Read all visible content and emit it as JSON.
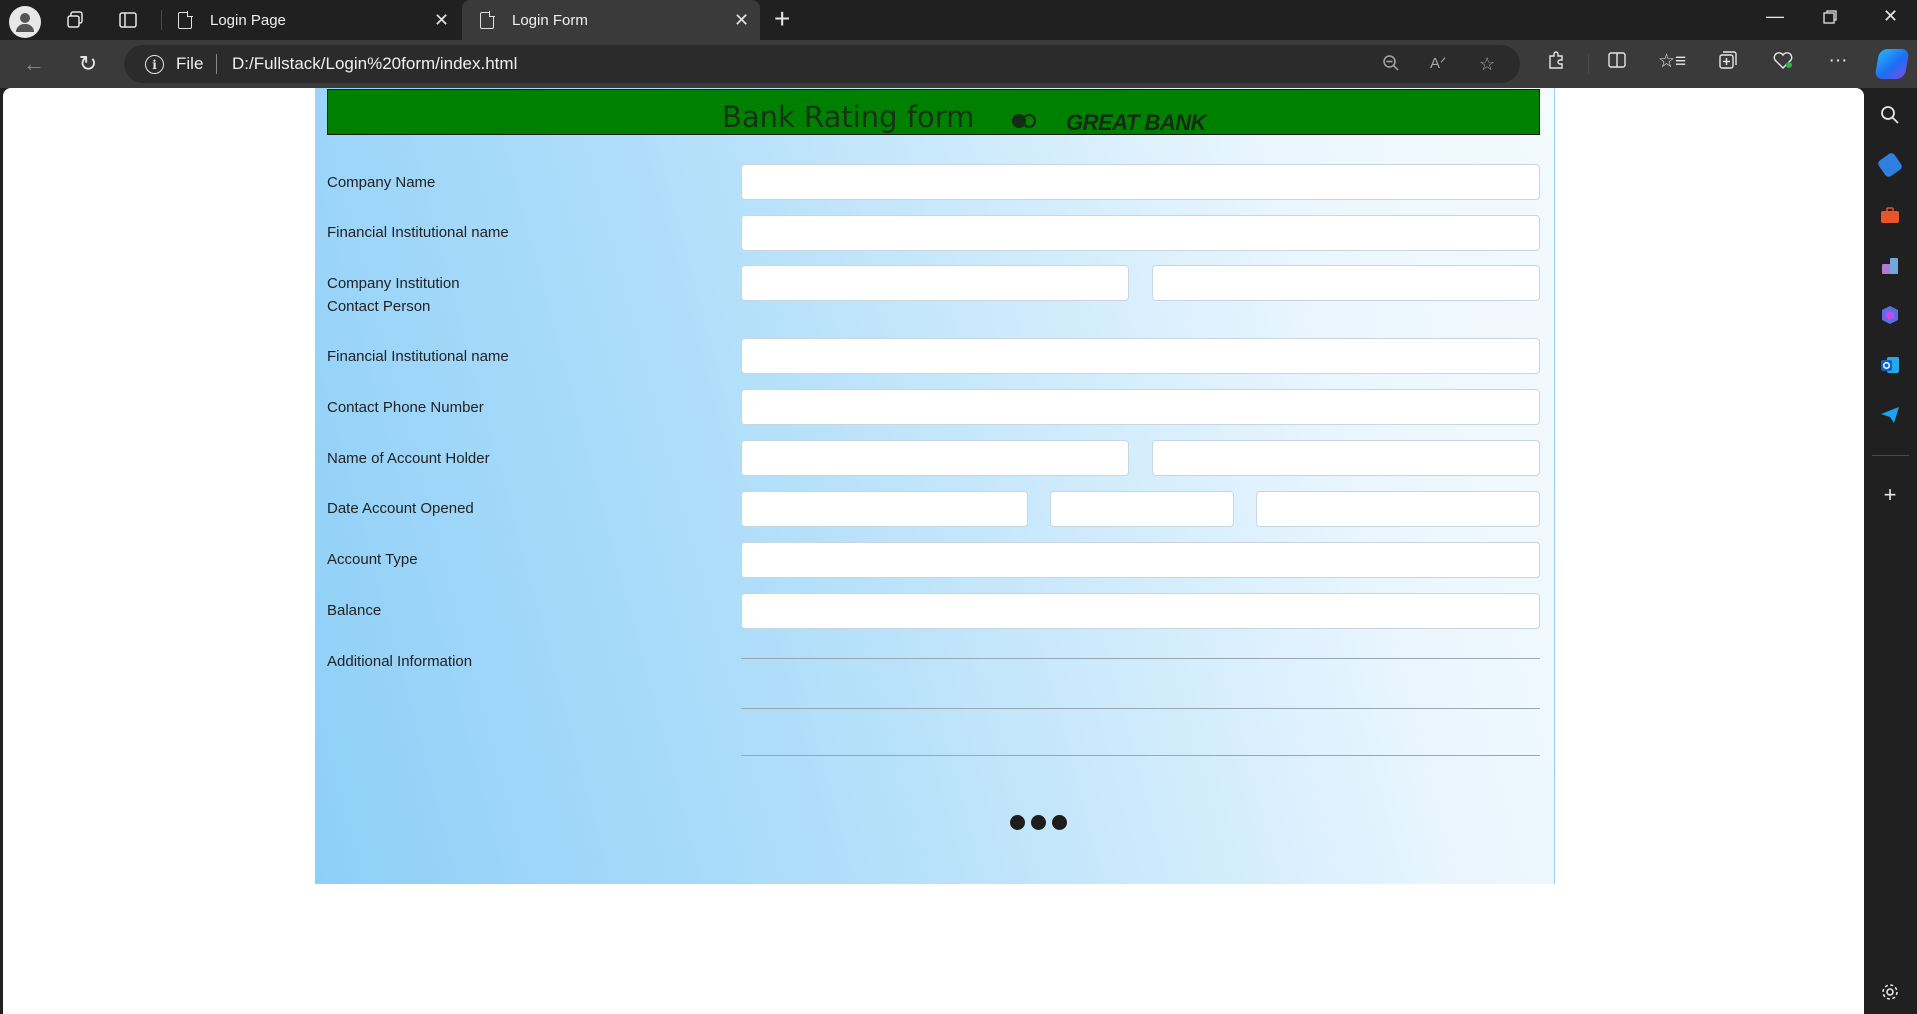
{
  "browser": {
    "tabs": [
      {
        "title": "Login Page",
        "active": false
      },
      {
        "title": "Login Form",
        "active": true
      }
    ],
    "address": {
      "scheme_label": "File",
      "url": "D:/Fullstack/Login%20form/index.html"
    }
  },
  "form": {
    "title": "Bank Rating form",
    "bank_name": "GREAT BANK",
    "labels": {
      "company_name": "Company Name",
      "financial_institution_1": "Financial Institutional name",
      "contact_person_line1": "Company Institution",
      "contact_person_line2": "Contact Person",
      "financial_institution_2": "Financial Institutional name",
      "contact_phone": "Contact Phone Number",
      "account_holder": "Name of Account Holder",
      "date_opened": "Date Account Opened",
      "account_type": "Account Type",
      "balance": "Balance",
      "additional_info": "Additional Information"
    },
    "header_color": "#008000"
  }
}
